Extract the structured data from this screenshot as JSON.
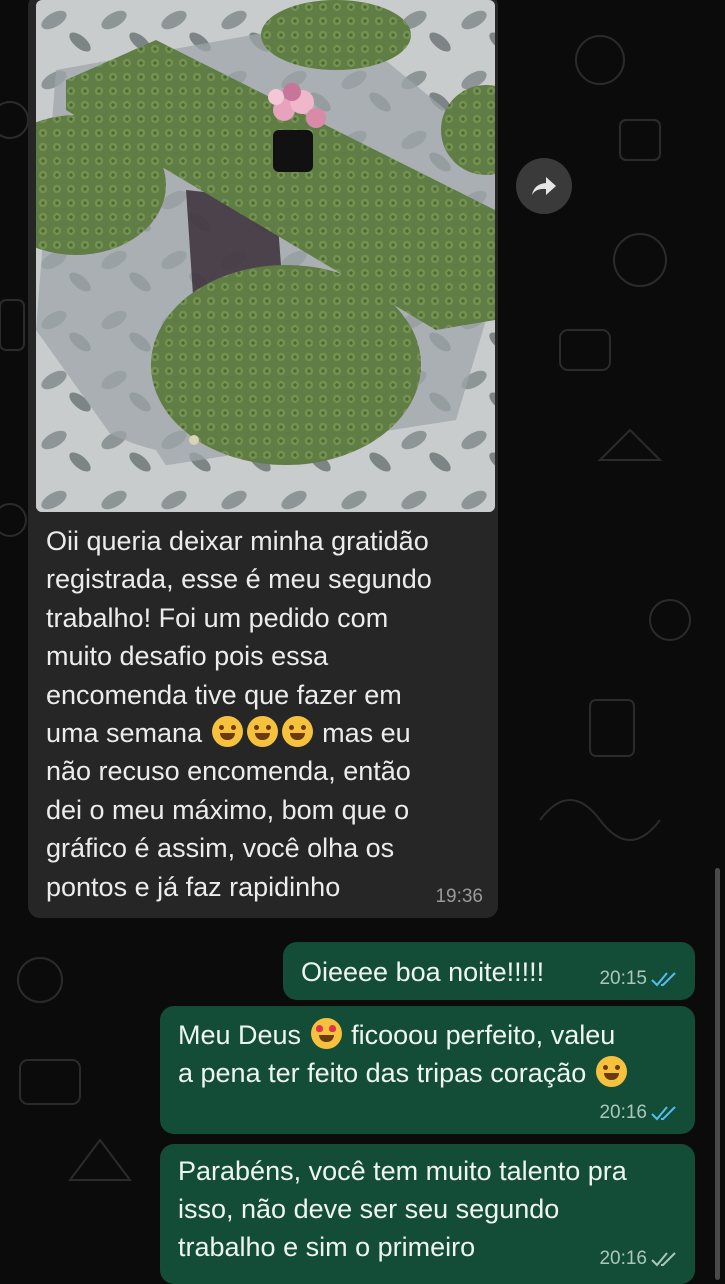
{
  "incoming": {
    "text_lines": [
      "Oii queria deixar minha gratidão",
      "registrada, esse é meu segundo",
      "trabalho! Foi um pedido com",
      "muito desafio pois essa",
      "encomenda tive que fazer em"
    ],
    "line6_a": "uma semana ",
    "line6_b": " mas eu",
    "text_tail_lines": [
      "não recuso encomenda, então",
      "dei o meu máximo, bom que o",
      "gráfico é assim, você olha os",
      "pontos e já faz rapidinho"
    ],
    "time": "19:36",
    "emojis": [
      "rofl-emoji",
      "sweat-smile-emoji",
      "joy-emoji"
    ]
  },
  "outgoing": [
    {
      "text": "Oieeee boa noite!!!!!",
      "time": "20:15"
    },
    {
      "text_a": "Meu Deus ",
      "text_b": " ficooou perfeito, valeu",
      "text_c": "a pena ter feito das tripas coração ",
      "time": "20:16"
    },
    {
      "text": "Parabéns, você tem muito talento pra\nisso, não deve ser seu segundo\ntrabalho e sim o primeiro",
      "time": "20:16"
    }
  ],
  "icons": {
    "forward": "forward-arrow-icon",
    "read_receipt": "double-check-icon"
  },
  "colors": {
    "incoming_bubble": "#262626",
    "outgoing_bubble": "#144d37",
    "read_tick": "#53bdeb",
    "crochet_green": "#5f7d44"
  }
}
